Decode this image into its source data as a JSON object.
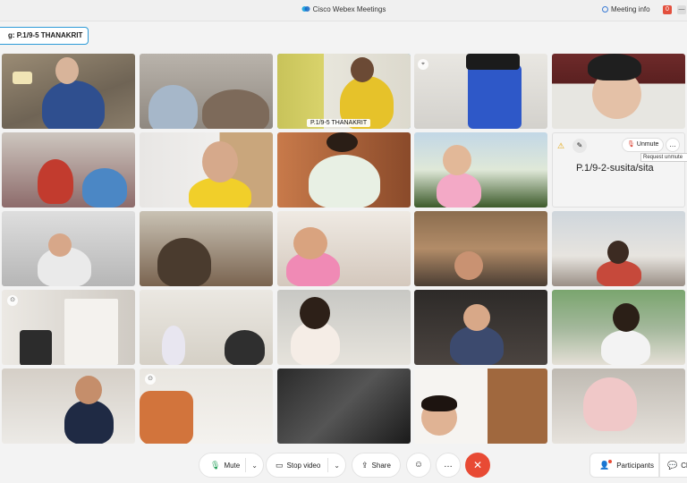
{
  "app": {
    "title": "Cisco Webex Meetings",
    "meeting_info": "Meeting info",
    "notif_count": "0"
  },
  "speaker": {
    "label": "g:  P.1/9-5 THANAKRIT"
  },
  "grid": {
    "active_name": "P.1/9-5 THANAKRIT",
    "avatar_tile": {
      "name": "P.1/9-2-susita/sita",
      "unmute_label": "Unmute",
      "tooltip": "Request unmute"
    }
  },
  "controls": {
    "mute": "Mute",
    "stop_video": "Stop video",
    "share": "Share",
    "participants": "Participants",
    "chat": "Ch"
  },
  "colors": {
    "accent": "#2d9bd8",
    "leave": "#e84a34",
    "mic": "#1f9d55"
  }
}
